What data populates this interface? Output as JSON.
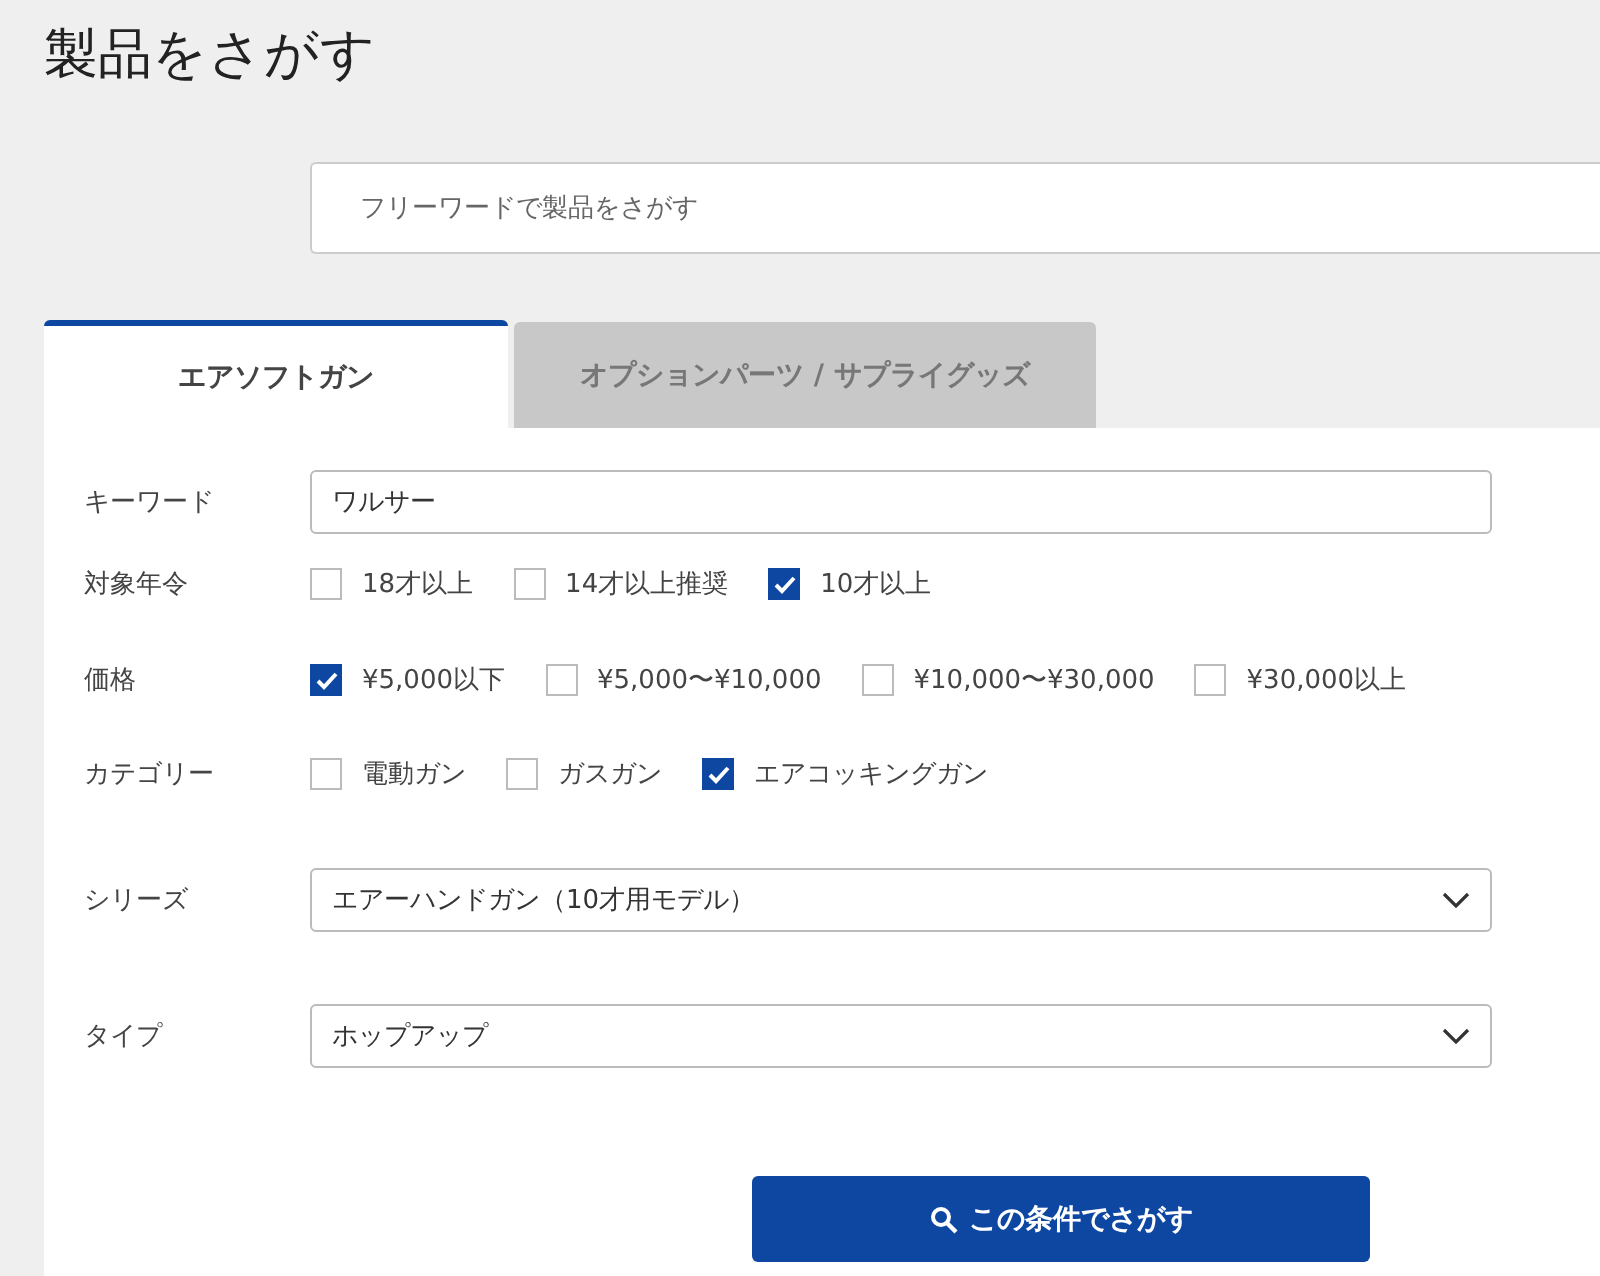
{
  "title": "製品をさがす",
  "search": {
    "placeholder": "フリーワードで製品をさがす"
  },
  "tabs": [
    {
      "label": "エアソフトガン",
      "selected": true
    },
    {
      "label": "オプションパーツ / サプライグッズ",
      "selected": false
    }
  ],
  "fields": [
    {
      "kind": "text",
      "label": "キーワード",
      "value": "ワルサー"
    },
    {
      "kind": "checks",
      "label": "対象年令",
      "options": [
        {
          "label": "18才以上",
          "checked": false
        },
        {
          "label": "14才以上推奨",
          "checked": false
        },
        {
          "label": "10才以上",
          "checked": true
        }
      ]
    },
    {
      "kind": "checks",
      "label": "価格",
      "options": [
        {
          "label": "¥5,000以下",
          "checked": true
        },
        {
          "label": "¥5,000〜¥10,000",
          "checked": false
        },
        {
          "label": "¥10,000〜¥30,000",
          "checked": false
        },
        {
          "label": "¥30,000以上",
          "checked": false
        }
      ]
    },
    {
      "kind": "checks",
      "label": "カテゴリー",
      "options": [
        {
          "label": "電動ガン",
          "checked": false
        },
        {
          "label": "ガスガン",
          "checked": false
        },
        {
          "label": "エアコッキングガン",
          "checked": true
        }
      ]
    },
    {
      "kind": "select",
      "label": "シリーズ",
      "value": "エアーハンドガン（10才用モデル）"
    },
    {
      "kind": "select",
      "label": "タイプ",
      "value": "ホップアップ"
    }
  ],
  "submit": {
    "label": "この条件でさがす"
  }
}
